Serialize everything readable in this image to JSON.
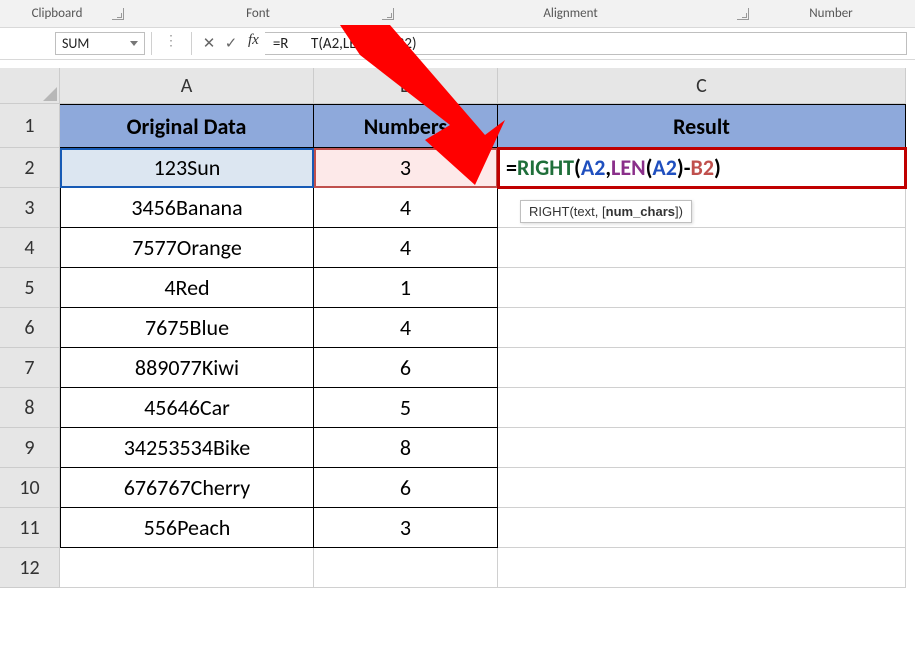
{
  "ribbon": {
    "groups": {
      "clipboard": "Clipboard",
      "font": "Font",
      "alignment": "Alignment",
      "number": "Number"
    }
  },
  "namebox": {
    "value": "SUM"
  },
  "fx_label": "fx",
  "cancel_glyph": "✕",
  "enter_glyph": "✓",
  "dots_glyph": "⋮",
  "formula_bar": "=RIGHT(A2,LEN(A2)-B2)",
  "formula_bar_truncated_left": "=R",
  "formula_bar_truncated_right": "T(A2,LEN(A2)-B2)",
  "columns": {
    "A": "A",
    "B": "B",
    "C": "C"
  },
  "row_labels": [
    "1",
    "2",
    "3",
    "4",
    "5",
    "6",
    "7",
    "8",
    "9",
    "10",
    "11",
    "12"
  ],
  "headers": {
    "A": "Original Data",
    "B": "Numbers",
    "C": "Result"
  },
  "rows": [
    {
      "A": "123Sun",
      "B": "3"
    },
    {
      "A": "3456Banana",
      "B": "4"
    },
    {
      "A": "7577Orange",
      "B": "4"
    },
    {
      "A": "4Red",
      "B": "1"
    },
    {
      "A": "7675Blue",
      "B": "4"
    },
    {
      "A": "889077Kiwi",
      "B": "6"
    },
    {
      "A": "45646Car",
      "B": "5"
    },
    {
      "A": "34253534Bike",
      "B": "8"
    },
    {
      "A": "676767Cherry",
      "B": "6"
    },
    {
      "A": "556Peach",
      "B": "3"
    }
  ],
  "c2_formula": {
    "eq": "=",
    "right": "RIGHT",
    "open": "(",
    "a2": "A2",
    "comma1": ",",
    "len": "LEN",
    "open2": "(",
    "a2b": "A2",
    "close2": ")",
    "minus": "-",
    "b2": "B2",
    "close": ")"
  },
  "tooltip": {
    "fn": "RIGHT",
    "sig_open": "(",
    "arg1": "text",
    "sep": ", ",
    "arg2_open": "[",
    "arg2": "num_chars",
    "arg2_close": "]",
    "sig_close": ")"
  },
  "colors": {
    "header_fill": "#8ea9db",
    "arrow": "#ff0000",
    "active_outline": "#c00000"
  }
}
